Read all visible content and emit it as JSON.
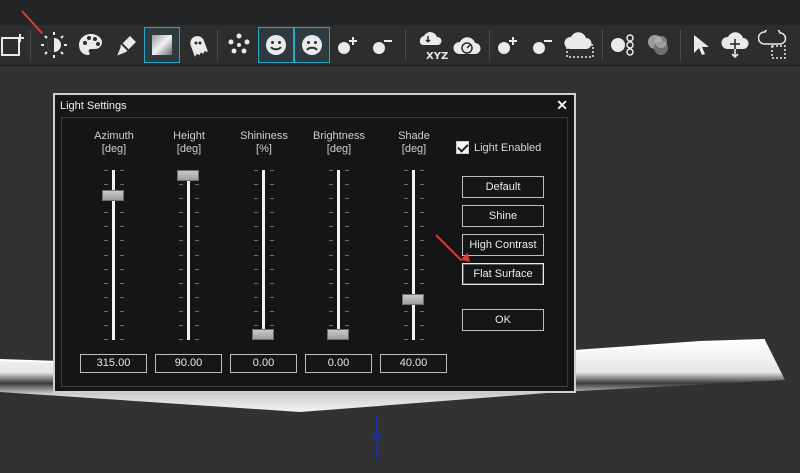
{
  "dialog": {
    "title": "Light Settings",
    "close_label": "✕",
    "light_enabled_label": "Light Enabled",
    "light_enabled": true,
    "sliders": [
      {
        "key": "azimuth",
        "label": "Azimuth",
        "unit": "[deg]",
        "value": "315.00",
        "level": 0.875
      },
      {
        "key": "height",
        "label": "Height",
        "unit": "[deg]",
        "value": "90.00",
        "level": 1.0
      },
      {
        "key": "shininess",
        "label": "Shininess",
        "unit": "[%]",
        "value": "0.00",
        "level": 0.0
      },
      {
        "key": "brightness",
        "label": "Brightness",
        "unit": "[deg]",
        "value": "0.00",
        "level": 0.0
      },
      {
        "key": "shade",
        "label": "Shade",
        "unit": "[deg]",
        "value": "40.00",
        "level": 0.222
      }
    ],
    "buttons": {
      "default": "Default",
      "shine": "Shine",
      "high_contrast": "High Contrast",
      "flat_surface": "Flat Surface",
      "ok": "OK"
    }
  },
  "toolbar": {
    "xyz_label": "XYZ",
    "icons": [
      "new-window-icon",
      "light-icon",
      "palette-icon",
      "edit-icon",
      "gradient-icon",
      "ghost-icon",
      "points-icon",
      "smile-icon",
      "frown-icon",
      "point-plus-icon",
      "point-minus-icon",
      "cloud-xyz-icon",
      "cloud-gauge-icon",
      "point-plus-icon",
      "point-minus-icon",
      "cloud-select-icon",
      "circles-icon",
      "merge-icon",
      "pointer-icon",
      "cloud-move-icon",
      "cloud-box-icon"
    ]
  },
  "colors": {
    "accent": "#2aa7c6",
    "annotation_arrow": "#d93b3b",
    "axis": "#1b2fa0"
  }
}
